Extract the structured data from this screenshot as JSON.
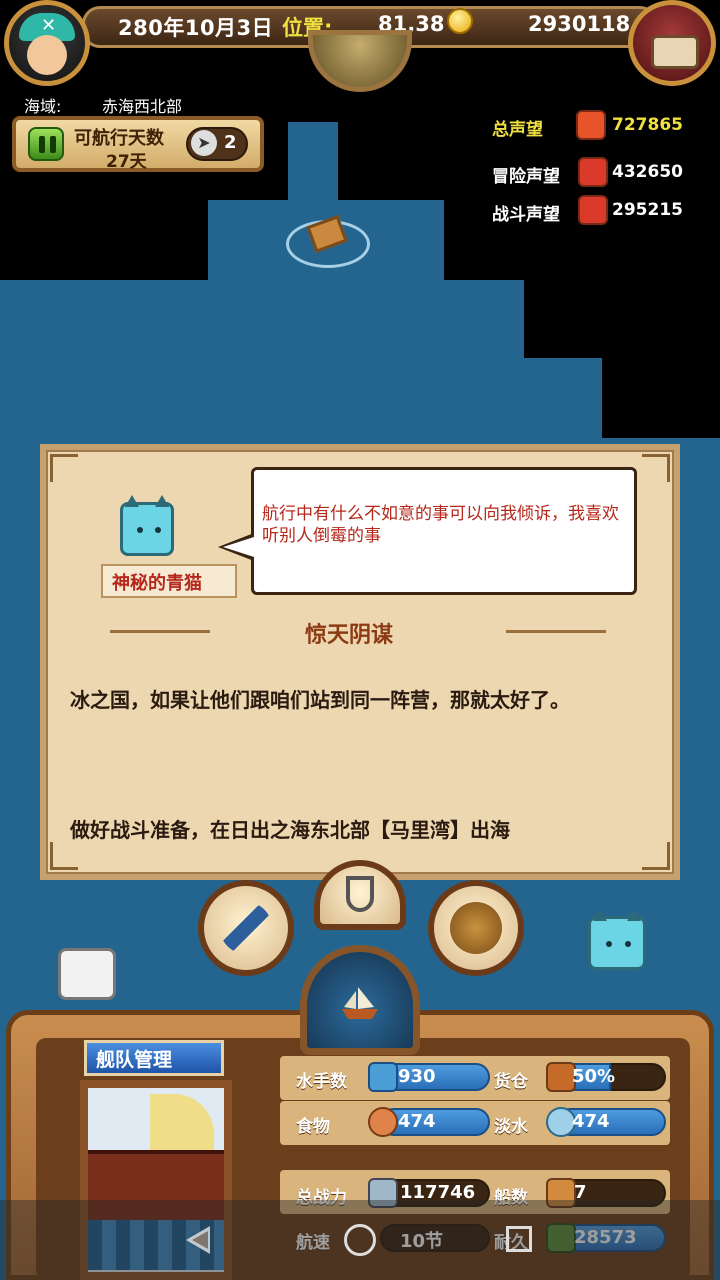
{
  "header": {
    "date": "280年10月3日",
    "position_label": "位置:",
    "position_value": "81,38",
    "gold": "2930118"
  },
  "region": {
    "label": "海域:",
    "value": "赤海西北部"
  },
  "navigation": {
    "title": "可航行天数",
    "days": "27天",
    "fast_forward_count": "2"
  },
  "reputation": {
    "total": {
      "label": "总声望",
      "value": "727865"
    },
    "adventure": {
      "label": "冒险声望",
      "value": "432650"
    },
    "battle": {
      "label": "战斗声望",
      "value": "295215"
    }
  },
  "dialog": {
    "npc_name": "神秘的青猫",
    "npc_speech": "航行中有什么不如意的事可以向我倾诉，我喜欢听别人倒霉的事",
    "quest_title": "惊天阴谋",
    "quest_text": "冰之国，如果让他们跟咱们站到同一阵营，那就太好了。",
    "quest_objective": "做好战斗准备，在日出之海东北部【马里湾】出海"
  },
  "fleet": {
    "title": "舰队管理",
    "sailors": {
      "label": "水手数",
      "value": "930"
    },
    "cargo": {
      "label": "货仓",
      "value": "50%"
    },
    "food": {
      "label": "食物",
      "value": "474"
    },
    "water": {
      "label": "淡水",
      "value": "474"
    },
    "power": {
      "label": "总战力",
      "value": "117746"
    },
    "ships": {
      "label": "船数",
      "value": "7"
    },
    "speed": {
      "label": "航速",
      "value": "10节"
    },
    "durability": {
      "label": "耐久",
      "value": "28573"
    }
  },
  "icons": [
    "avatar-icon",
    "treasure-chest-icon",
    "gold-coin-icon",
    "globe-icon",
    "pause-icon",
    "fast-forward-icon",
    "telescope-icon",
    "anchor-icon",
    "world-map-icon",
    "ship-icon",
    "cat-npc-icon"
  ],
  "colors": {
    "sea": "#23658f",
    "fog": "#000000",
    "accent_gold": "#f0e040",
    "npc_text": "#b5281b",
    "stat_pill": "#2a6fb8"
  }
}
